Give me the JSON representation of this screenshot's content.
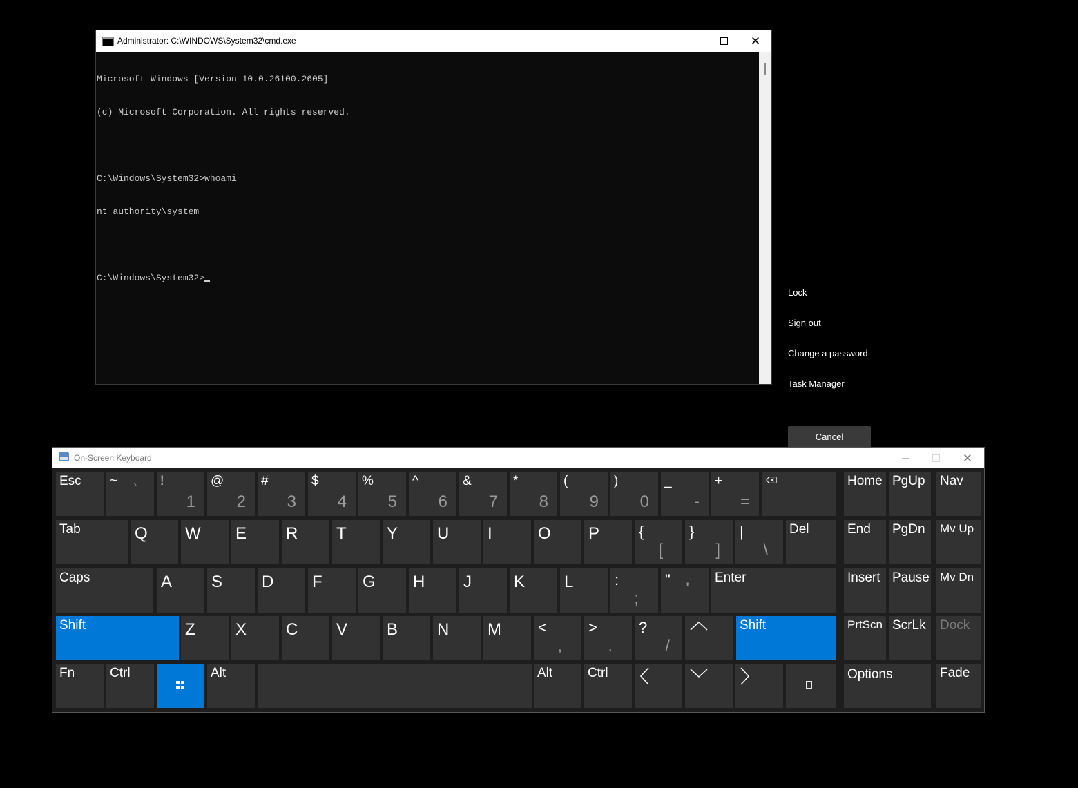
{
  "cmd": {
    "title": "Administrator: C:\\WINDOWS\\System32\\cmd.exe",
    "lines": [
      "Microsoft Windows [Version 10.0.26100.2605]",
      "(c) Microsoft Corporation. All rights reserved.",
      "",
      "C:\\Windows\\System32>whoami",
      "nt authority\\system",
      "",
      "C:\\Windows\\System32>"
    ]
  },
  "security_menu": {
    "items": [
      "Lock",
      "Sign out",
      "Change a password",
      "Task Manager"
    ],
    "cancel_label": "Cancel"
  },
  "osk": {
    "title": "On-Screen Keyboard",
    "keys": {
      "esc": "Esc",
      "tilde_top": "~",
      "tilde_bottom": "`",
      "excl": "!",
      "one": "1",
      "at": "@",
      "two": "2",
      "hash": "#",
      "three": "3",
      "dollar": "$",
      "four": "4",
      "percent": "%",
      "five": "5",
      "caret": "^",
      "six": "6",
      "amp": "&",
      "seven": "7",
      "star": "*",
      "eight": "8",
      "lparen": "(",
      "nine": "9",
      "rparen": ")",
      "zero": "0",
      "underscore": "_",
      "minus": "-",
      "plus": "+",
      "equals": "=",
      "tab": "Tab",
      "q": "Q",
      "w": "W",
      "e": "E",
      "r": "R",
      "t": "T",
      "y": "Y",
      "u": "U",
      "i": "I",
      "o": "O",
      "p": "P",
      "lbrace": "{",
      "lbracket": "[",
      "rbrace": "}",
      "rbracket": "]",
      "pipe": "|",
      "backslash": "\\",
      "del": "Del",
      "caps": "Caps",
      "a": "A",
      "s": "S",
      "d": "D",
      "f": "F",
      "g": "G",
      "h": "H",
      "j": "J",
      "k": "K",
      "l": "L",
      "colon": ":",
      "semicolon": ";",
      "quote": "\"",
      "apostrophe": "'",
      "enter": "Enter",
      "shift": "Shift",
      "z": "Z",
      "x": "X",
      "c": "C",
      "v": "V",
      "b": "B",
      "n": "N",
      "m": "M",
      "lt": "<",
      "comma": ",",
      "gt": ">",
      "period": ".",
      "question": "?",
      "slash": "/",
      "fn": "Fn",
      "ctrl": "Ctrl",
      "alt": "Alt",
      "home": "Home",
      "pgup": "PgUp",
      "nav": "Nav",
      "end": "End",
      "pgdn": "PgDn",
      "mvup": "Mv Up",
      "insert": "Insert",
      "pause": "Pause",
      "mvdn": "Mv Dn",
      "prtscn": "PrtScn",
      "scrlk": "ScrLk",
      "dock": "Dock",
      "options": "Options",
      "fade": "Fade"
    },
    "icons": {
      "backspace": "backspace-icon",
      "up": "up-arrow-icon",
      "down": "down-arrow-icon",
      "left": "left-arrow-icon",
      "right": "right-arrow-icon",
      "windows": "windows-logo-icon",
      "menu": "context-menu-icon"
    },
    "colors": {
      "key": "#323232",
      "active": "#0078d7",
      "background": "#1e1e1e"
    }
  }
}
